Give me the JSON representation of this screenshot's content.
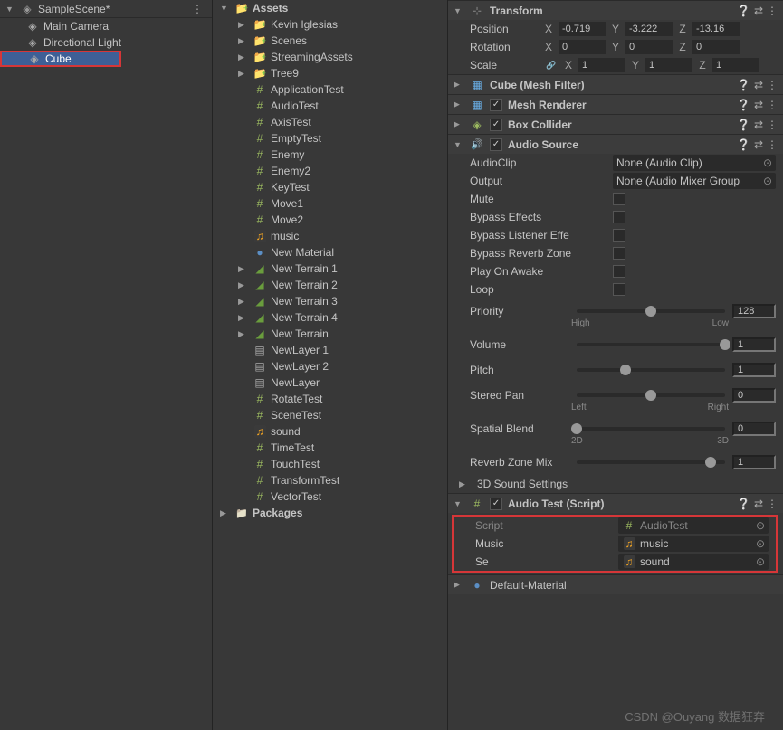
{
  "hierarchy": {
    "scene": "SampleScene*",
    "items": [
      "Main Camera",
      "Directional Light",
      "Cube"
    ],
    "selected": "Cube"
  },
  "project": {
    "root": "Assets",
    "folders": [
      "Kevin Iglesias",
      "Scenes",
      "StreamingAssets",
      "Tree9"
    ],
    "assets": [
      {
        "name": "ApplicationTest",
        "type": "script"
      },
      {
        "name": "AudioTest",
        "type": "script"
      },
      {
        "name": "AxisTest",
        "type": "script"
      },
      {
        "name": "EmptyTest",
        "type": "script"
      },
      {
        "name": "Enemy",
        "type": "script"
      },
      {
        "name": "Enemy2",
        "type": "script"
      },
      {
        "name": "KeyTest",
        "type": "script"
      },
      {
        "name": "Move1",
        "type": "script"
      },
      {
        "name": "Move2",
        "type": "script"
      },
      {
        "name": "music",
        "type": "music"
      },
      {
        "name": "New Material",
        "type": "mat"
      },
      {
        "name": "New Terrain 1",
        "type": "terrain"
      },
      {
        "name": "New Terrain 2",
        "type": "terrain"
      },
      {
        "name": "New Terrain 3",
        "type": "terrain"
      },
      {
        "name": "New Terrain 4",
        "type": "terrain"
      },
      {
        "name": "New Terrain",
        "type": "terrain"
      },
      {
        "name": "NewLayer 1",
        "type": "layer"
      },
      {
        "name": "NewLayer 2",
        "type": "layer"
      },
      {
        "name": "NewLayer",
        "type": "layer"
      },
      {
        "name": "RotateTest",
        "type": "script"
      },
      {
        "name": "SceneTest",
        "type": "script"
      },
      {
        "name": "sound",
        "type": "music"
      },
      {
        "name": "TimeTest",
        "type": "script"
      },
      {
        "name": "TouchTest",
        "type": "script"
      },
      {
        "name": "TransformTest",
        "type": "script"
      },
      {
        "name": "VectorTest",
        "type": "script"
      }
    ],
    "packages": "Packages"
  },
  "inspector": {
    "transform": {
      "title": "Transform",
      "position": {
        "label": "Position",
        "x": "-0.719",
        "y": "-3.222",
        "z": "-13.16"
      },
      "rotation": {
        "label": "Rotation",
        "x": "0",
        "y": "0",
        "z": "0"
      },
      "scale": {
        "label": "Scale",
        "x": "1",
        "y": "1",
        "z": "1"
      }
    },
    "components": [
      {
        "title": "Cube (Mesh Filter)",
        "icon": "mesh",
        "check": false
      },
      {
        "title": "Mesh Renderer",
        "icon": "renderer",
        "check": true
      },
      {
        "title": "Box Collider",
        "icon": "collider",
        "check": true
      }
    ],
    "audioSource": {
      "title": "Audio Source",
      "audioClip": {
        "label": "AudioClip",
        "value": "None (Audio Clip)"
      },
      "output": {
        "label": "Output",
        "value": "None (Audio Mixer Group"
      },
      "mute": "Mute",
      "bypassEffects": "Bypass Effects",
      "bypassListener": "Bypass Listener Effe",
      "bypassReverb": "Bypass Reverb Zone",
      "playOnAwake": "Play On Awake",
      "loop": "Loop",
      "priority": {
        "label": "Priority",
        "value": "128",
        "low": "High",
        "high": "Low",
        "pos": 50
      },
      "volume": {
        "label": "Volume",
        "value": "1",
        "pos": 100
      },
      "pitch": {
        "label": "Pitch",
        "value": "1",
        "pos": 33
      },
      "stereoPan": {
        "label": "Stereo Pan",
        "value": "0",
        "low": "Left",
        "high": "Right",
        "pos": 50
      },
      "spatialBlend": {
        "label": "Spatial Blend",
        "value": "0",
        "low": "2D",
        "high": "3D",
        "pos": 0
      },
      "reverbZone": {
        "label": "Reverb Zone Mix",
        "value": "1",
        "pos": 90
      },
      "sound3d": "3D Sound Settings"
    },
    "audioTest": {
      "title": "Audio Test (Script)",
      "script": {
        "label": "Script",
        "value": "AudioTest"
      },
      "music": {
        "label": "Music",
        "value": "music"
      },
      "se": {
        "label": "Se",
        "value": "sound"
      }
    },
    "defaultMat": "Default-Material"
  },
  "watermark": "CSDN @Ouyang 数据狂奔"
}
